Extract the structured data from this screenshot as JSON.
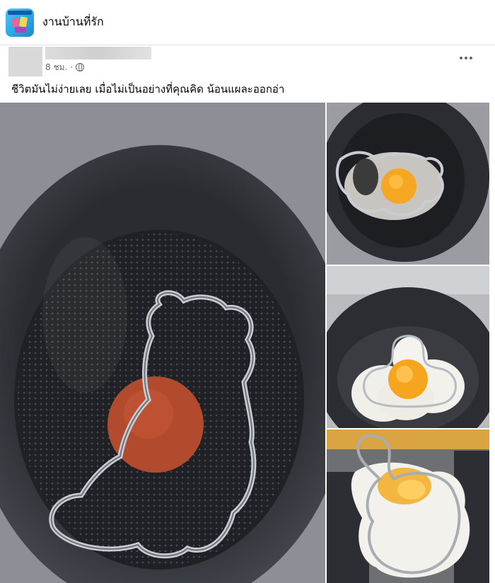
{
  "group": {
    "name": "งานบ้านที่รัก",
    "logo_icon": "group-logo-icon"
  },
  "post": {
    "time": "8 ชม.",
    "separator": "·",
    "privacy_icon": "globe-icon",
    "text": "ชีวิตมันไม่ง่ายเลย เมื่อไม่เป็นอย่างที่คุณคิด น้อนแผละออกอ่า",
    "more_icon": "more-options-icon"
  },
  "colors": {
    "background": "#f0f2f5",
    "card": "#ffffff",
    "secondary_text": "#65676b"
  }
}
